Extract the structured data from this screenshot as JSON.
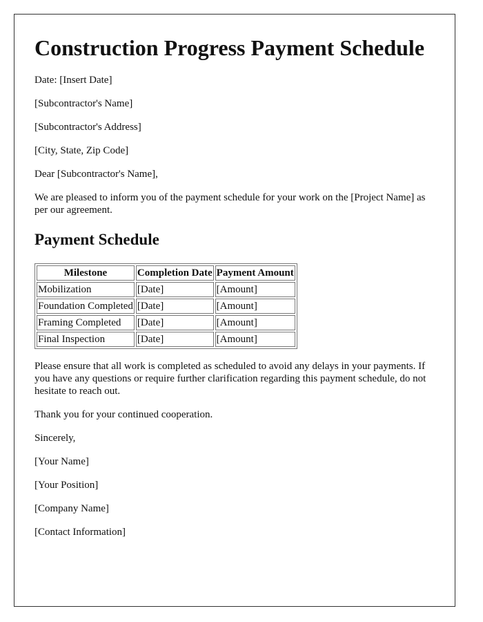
{
  "title": "Construction Progress Payment Schedule",
  "header_lines": {
    "date": "Date: [Insert Date]",
    "name": "[Subcontractor's Name]",
    "address": "[Subcontractor's Address]",
    "city": "[City, State, Zip Code]"
  },
  "salutation": "Dear [Subcontractor's Name],",
  "intro": "We are pleased to inform you of the payment schedule for your work on the [Project Name] as per our agreement.",
  "section_title": "Payment Schedule",
  "table": {
    "headers": [
      "Milestone",
      "Completion Date",
      "Payment Amount"
    ],
    "rows": [
      [
        "Mobilization",
        "[Date]",
        "[Amount]"
      ],
      [
        "Foundation Completed",
        "[Date]",
        "[Amount]"
      ],
      [
        "Framing Completed",
        "[Date]",
        "[Amount]"
      ],
      [
        "Final Inspection",
        "[Date]",
        "[Amount]"
      ]
    ]
  },
  "body": "Please ensure that all work is completed as scheduled to avoid any delays in your payments. If you have any questions or require further clarification regarding this payment schedule, do not hesitate to reach out.",
  "thanks": "Thank you for your continued cooperation.",
  "closing": "Sincerely,",
  "signature": {
    "name": "[Your Name]",
    "position": "[Your Position]",
    "company": "[Company Name]",
    "contact": "[Contact Information]"
  }
}
